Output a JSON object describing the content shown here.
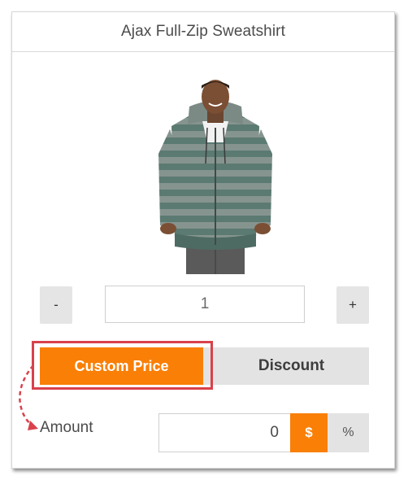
{
  "product": {
    "title": "Ajax Full-Zip Sweatshirt",
    "image_subject": "man wearing gray and green striped full-zip hooded sweatshirt"
  },
  "quantity": {
    "minus_label": "-",
    "value": "1",
    "plus_label": "+"
  },
  "tabs": {
    "custom_price_label": "Custom Price",
    "discount_label": "Discount",
    "active": "custom_price"
  },
  "amount": {
    "label": "Amount",
    "value": "0",
    "unit_dollar": "$",
    "unit_percent": "%",
    "active_unit": "$"
  },
  "colors": {
    "accent": "#f97f06",
    "highlight": "#d9414b",
    "inactive": "#e3e3e3"
  }
}
